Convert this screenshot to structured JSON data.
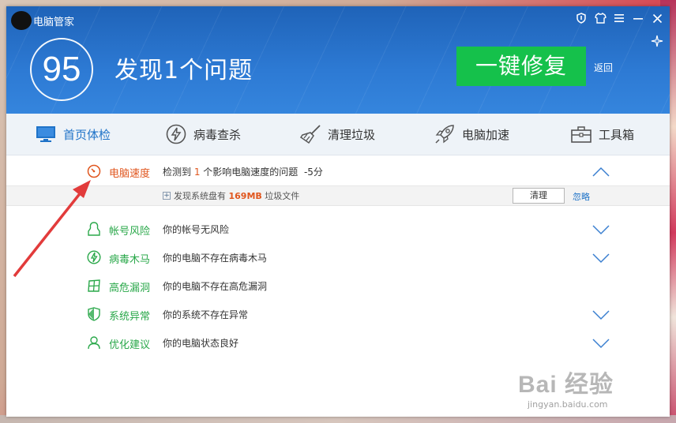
{
  "window": {
    "title": "电脑管家"
  },
  "title_icons": [
    "shield-icon",
    "shirt-icon",
    "menu-icon",
    "minimize-icon",
    "close-icon"
  ],
  "header": {
    "score": "95",
    "headline": "发现1个问题",
    "fix_button": "一键修复",
    "back_link": "返回"
  },
  "tabs": [
    {
      "label": "首页体检",
      "icon": "monitor-icon",
      "active": true
    },
    {
      "label": "病毒查杀",
      "icon": "lightning-shield-icon"
    },
    {
      "label": "清理垃圾",
      "icon": "broom-icon"
    },
    {
      "label": "电脑加速",
      "icon": "rocket-icon"
    },
    {
      "label": "工具箱",
      "icon": "toolbox-icon"
    }
  ],
  "checks": [
    {
      "name": "电脑速度",
      "desc_prefix": "检测到 ",
      "count": "1",
      "desc_suffix": " 个影响电脑速度的问题",
      "score": "-5分",
      "icon": "speedometer-icon",
      "expanded": true
    },
    {
      "name": "帐号风险",
      "desc": "你的帐号无风险",
      "icon": "user-shield-icon"
    },
    {
      "name": "病毒木马",
      "desc": "你的电脑不存在病毒木马",
      "icon": "virus-icon"
    },
    {
      "name": "高危漏洞",
      "desc": "你的电脑不存在高危漏洞",
      "icon": "windows-icon"
    },
    {
      "name": "系统异常",
      "desc": "你的系统不存在异常",
      "icon": "system-shield-icon"
    },
    {
      "name": "优化建议",
      "desc": "你的电脑状态良好",
      "icon": "person-icon"
    }
  ],
  "subitem": {
    "text_prefix": "发现系统盘有 ",
    "size": "169MB",
    "text_suffix": " 垃圾文件",
    "clean_button": "清理",
    "ignore_link": "忽略"
  },
  "watermark": {
    "main": "Bai 经验",
    "sub": "jingyan.baidu.com"
  },
  "colors": {
    "header_blue": "#2a6fc9",
    "fix_green": "#15c14b",
    "ok_green": "#2aa84a",
    "alert_orange": "#e0561e",
    "arrow_red": "#e23b3b"
  }
}
